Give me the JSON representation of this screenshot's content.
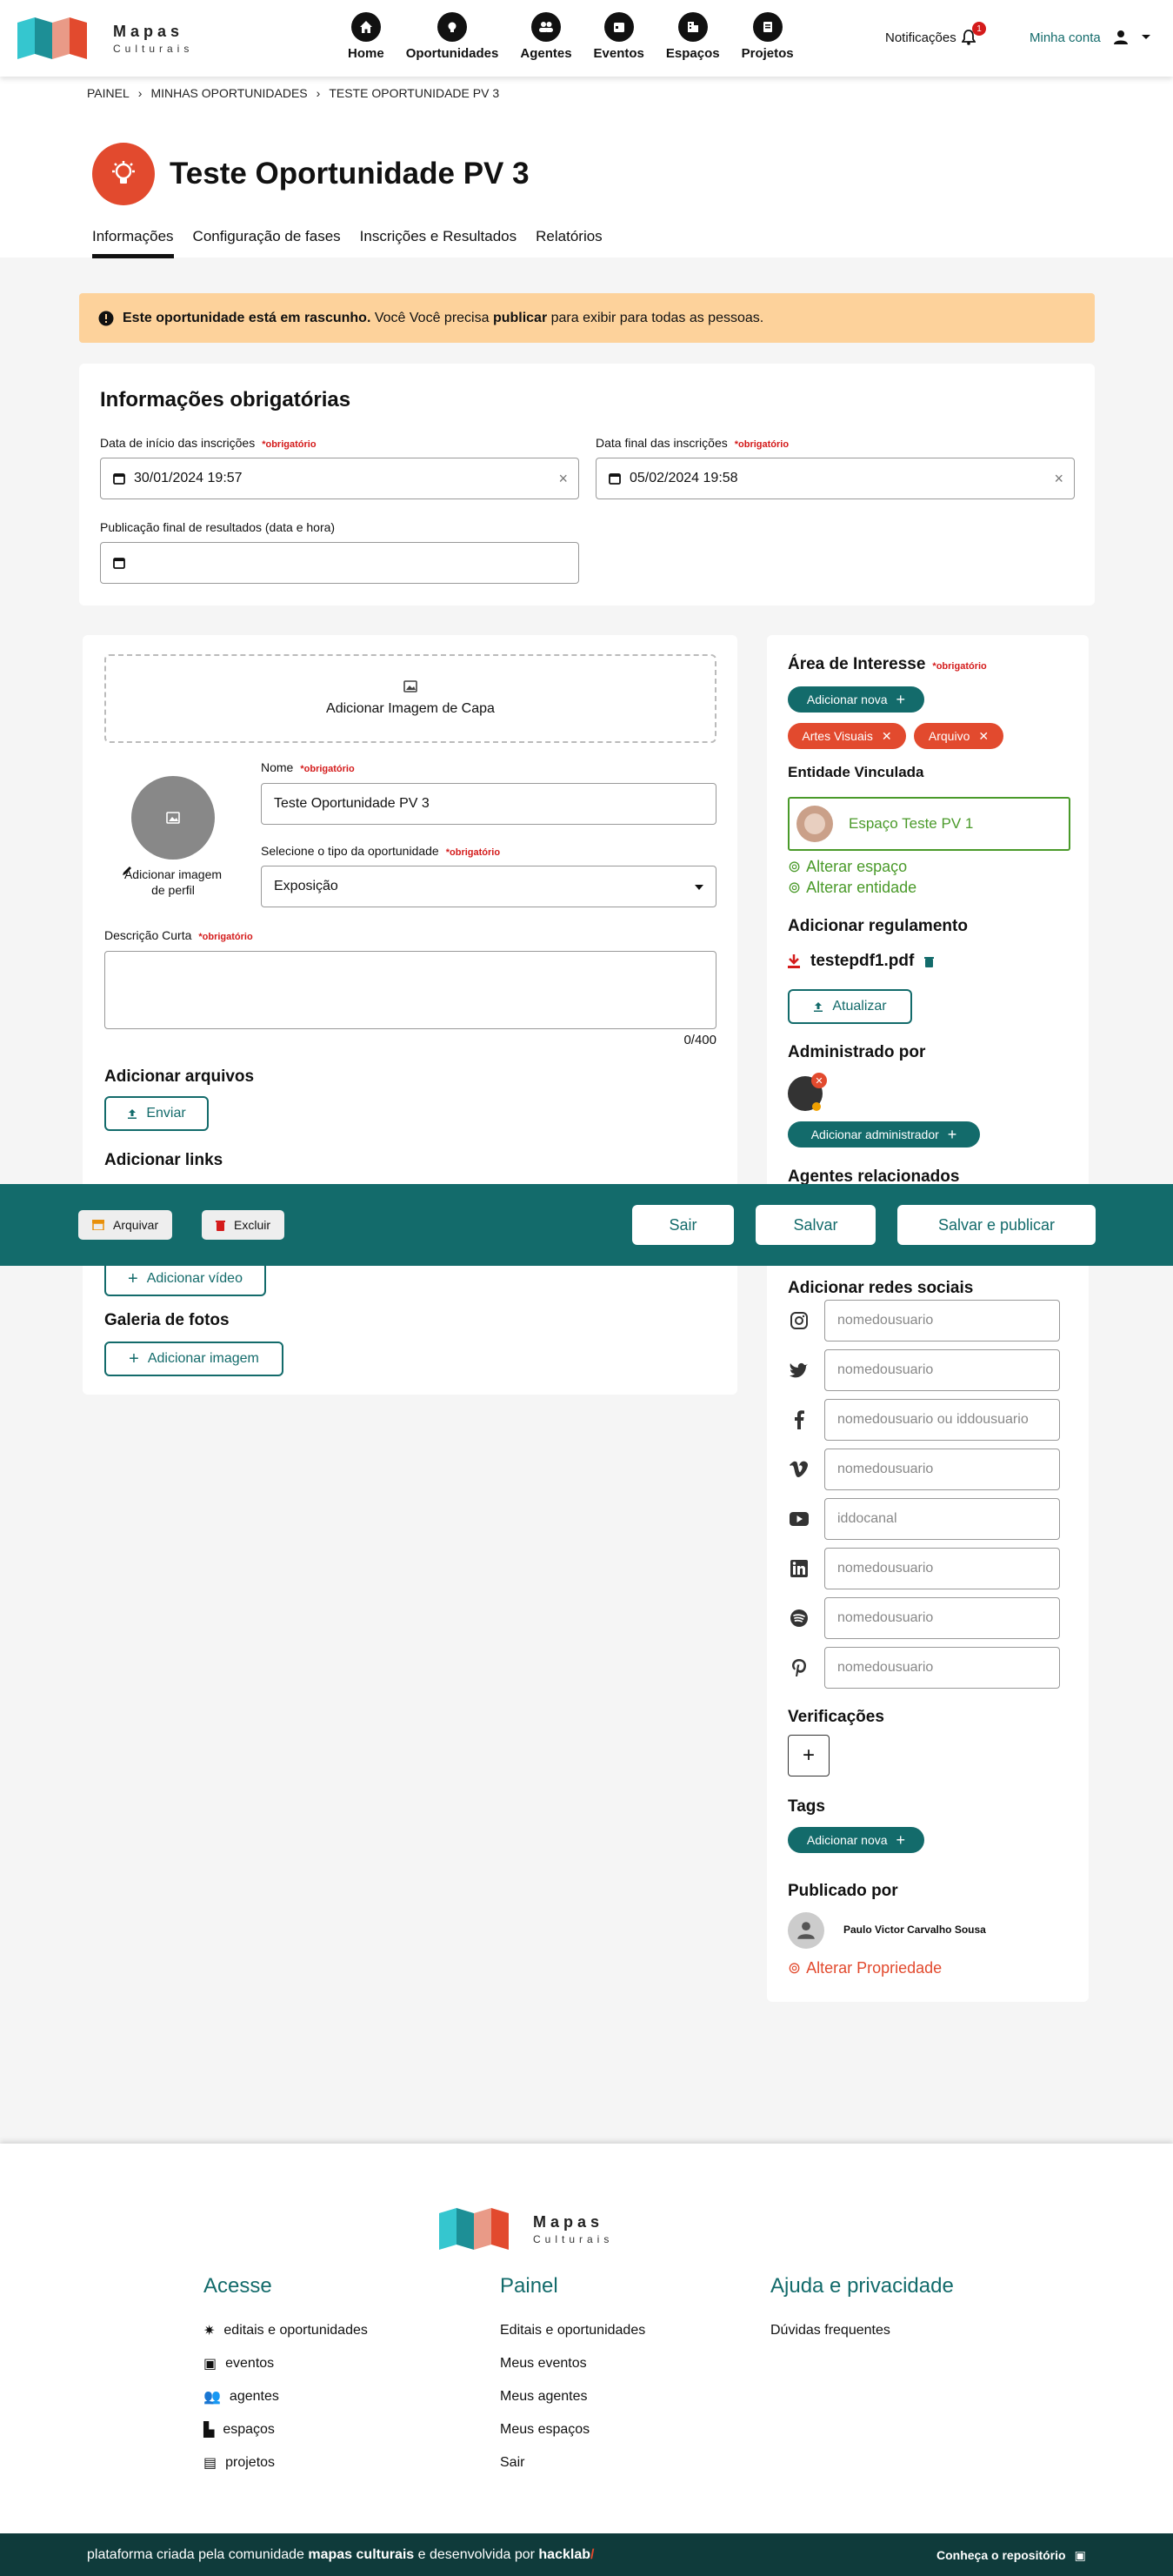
{
  "header": {
    "logo_title": "Mapas",
    "logo_subtitle": "Culturais",
    "nav": [
      {
        "label": "Home",
        "icon": "home-icon"
      },
      {
        "label": "Oportunidades",
        "icon": "lightbulb-icon"
      },
      {
        "label": "Agentes",
        "icon": "users-icon"
      },
      {
        "label": "Eventos",
        "icon": "calendar-icon"
      },
      {
        "label": "Espaços",
        "icon": "building-icon"
      },
      {
        "label": "Projetos",
        "icon": "project-icon"
      }
    ],
    "notifications_label": "Notificações",
    "notifications_count": "1",
    "account_label": "Minha conta"
  },
  "breadcrumb": [
    "Painel",
    "Minhas oportunidades",
    "Teste Oportunidade PV 3"
  ],
  "page": {
    "title": "Teste Oportunidade PV 3",
    "tabs": [
      "Informações",
      "Configuração de fases",
      "Inscrições e Resultados",
      "Relatórios"
    ]
  },
  "banner": {
    "strong": "Este oportunidade está em rascunho.",
    "text1": " Você Você precisa ",
    "strong2": "publicar",
    "text2": " para exibir para todas as pessoas."
  },
  "required_info": {
    "title": "Informações obrigatórias",
    "start_label": "Data de início das inscrições",
    "start_value": "30/01/2024 19:57",
    "end_label": "Data final das inscrições",
    "end_value": "05/02/2024 19:58",
    "result_label": "Publicação final de resultados (data e hora)",
    "result_value": "",
    "required_tag": "*obrigatório"
  },
  "main_form": {
    "cover_label": "Adicionar Imagem de Capa",
    "profile_image_label": "Adicionar imagem de perfil",
    "name_label": "Nome",
    "name_value": "Teste Oportunidade PV 3",
    "type_label": "Selecione o tipo da oportunidade",
    "type_value": "Exposição",
    "short_desc_label": "Descrição Curta",
    "char_count": "0/400",
    "files_title": "Adicionar arquivos",
    "files_button": "Enviar",
    "links_title": "Adicionar links",
    "video_button": "Adicionar vídeo",
    "gallery_title": "Galeria de fotos",
    "gallery_button": "Adicionar imagem"
  },
  "sidebar": {
    "interest_title": "Área de Interesse",
    "add_new": "Adicionar nova",
    "interests": [
      "Artes Visuais",
      "Arquivo"
    ],
    "linked_entity_title": "Entidade Vinculada",
    "linked_entity": "Espaço Teste PV 1",
    "change_space": "Alterar espaço",
    "change_entity": "Alterar entidade",
    "regulation_title": "Adicionar regulamento",
    "regulation_file": "testepdf1.pdf",
    "update_button": "Atualizar",
    "admin_title": "Administrado por",
    "add_admin": "Adicionar administrador",
    "related_agents_title": "Agentes relacionados",
    "social_title": "Adicionar redes sociais",
    "social": [
      {
        "icon": "instagram-icon",
        "placeholder": "nomedousuario"
      },
      {
        "icon": "twitter-icon",
        "placeholder": "nomedousuario"
      },
      {
        "icon": "facebook-icon",
        "placeholder": "nomedousuario ou iddousuario"
      },
      {
        "icon": "vimeo-icon",
        "placeholder": "nomedousuario"
      },
      {
        "icon": "youtube-icon",
        "placeholder": "iddocanal"
      },
      {
        "icon": "linkedin-icon",
        "placeholder": "nomedousuario"
      },
      {
        "icon": "spotify-icon",
        "placeholder": "nomedousuario"
      },
      {
        "icon": "pinterest-icon",
        "placeholder": "nomedousuario"
      }
    ],
    "verifications_title": "Verificações",
    "tags_title": "Tags",
    "published_by_title": "Publicado por",
    "published_by": "Paulo Victor Carvalho Sousa",
    "change_owner": "Alterar Propriedade"
  },
  "action_bar": {
    "archive": "Arquivar",
    "delete": "Excluir",
    "exit": "Sair",
    "save": "Salvar",
    "save_publish": "Salvar e publicar"
  },
  "footer": {
    "col1_title": "Acesse",
    "col1_links": [
      "editais e oportunidades",
      "eventos",
      "agentes",
      "espaços",
      "projetos"
    ],
    "col2_title": "Painel",
    "col2_links": [
      "Editais e oportunidades",
      "Meus eventos",
      "Meus agentes",
      "Meus espaços",
      "Sair"
    ],
    "col3_title": "Ajuda e privacidade",
    "col3_links": [
      "Dúvidas frequentes"
    ],
    "copy_prefix": "plataforma criada pela comunidade ",
    "copy_brand1": "mapas culturais",
    "copy_mid": " e desenvolvida por ",
    "copy_brand2": "hacklab",
    "copy_slash": "/",
    "repo": "Conheça o repositório"
  },
  "colors": {
    "primary": "#136b6b",
    "accent": "#e24a2e",
    "warning": "#fdd29b",
    "required": "#d41b1b",
    "link_green": "#4a9a2a"
  }
}
